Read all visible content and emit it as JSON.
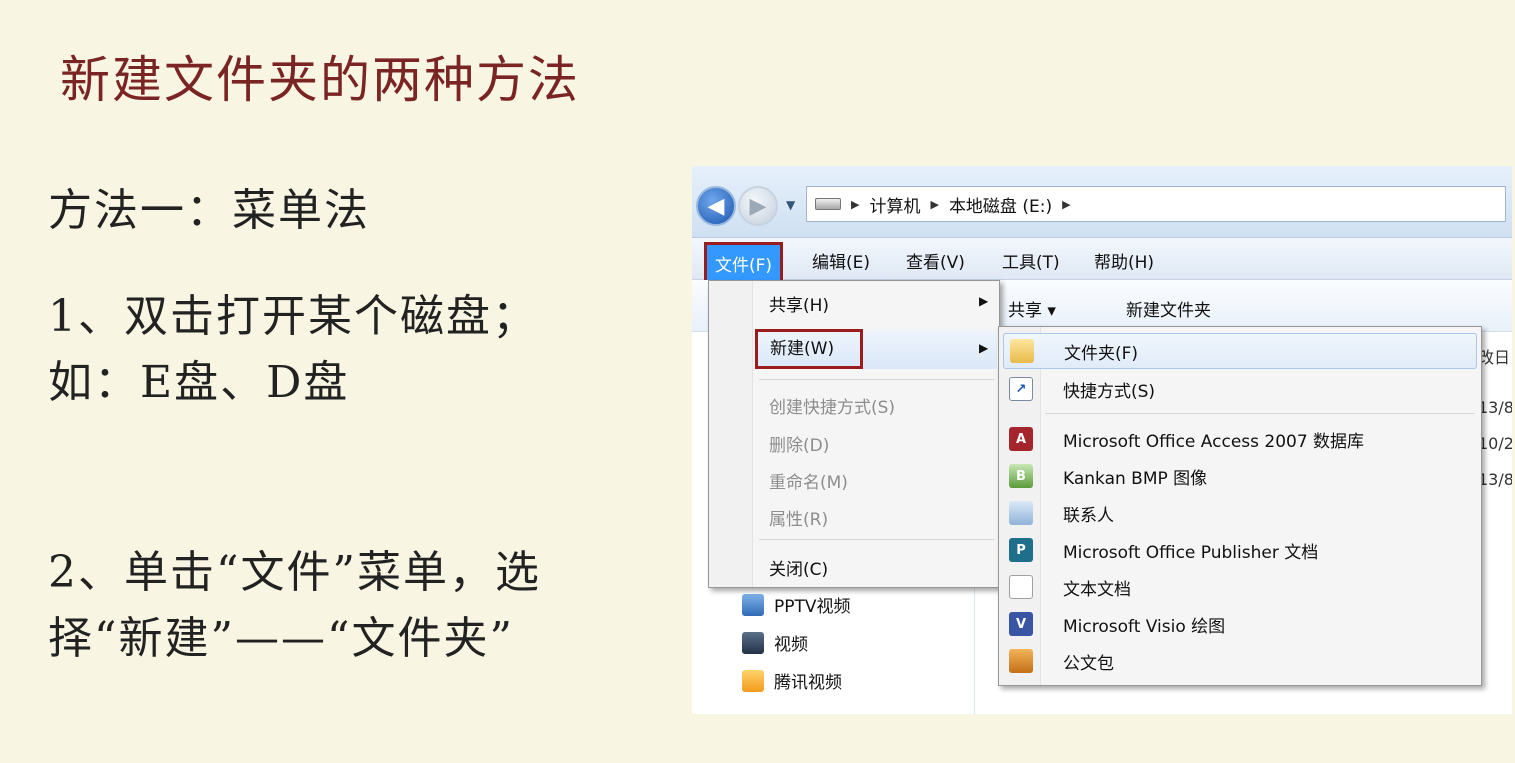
{
  "slide": {
    "title": "新建文件夹的两种方法",
    "method_heading": "方法一：菜单法",
    "step1": "1、双击打开某个磁盘；如：E盘、D盘",
    "step2": "2、单击“文件”菜单，选择“新建”——“文件夹”"
  },
  "explorer": {
    "breadcrumb": [
      "计算机",
      "本地磁盘 (E:)"
    ],
    "menu": {
      "file": "文件(F)",
      "edit": "编辑(E)",
      "view": "查看(V)",
      "tools": "工具(T)",
      "help": "帮助(H)"
    },
    "toolbar": {
      "share": "共享 ▾",
      "new_folder": "新建文件夹"
    },
    "date_col_header": "改日",
    "date_cells": [
      "13/8",
      "10/2",
      "13/8"
    ],
    "nav_items": [
      "PPTV视频",
      "视频",
      "腾讯视频"
    ],
    "file_menu": {
      "share": "共享(H)",
      "new": "新建(W)",
      "create_shortcut": "创建快捷方式(S)",
      "delete": "删除(D)",
      "rename": "重命名(M)",
      "properties": "属性(R)",
      "close": "关闭(C)"
    },
    "new_submenu": {
      "folder": "文件夹(F)",
      "shortcut": "快捷方式(S)",
      "access": "Microsoft Office Access 2007 数据库",
      "bmp": "Kankan BMP 图像",
      "contact": "联系人",
      "publisher": "Microsoft Office Publisher 文档",
      "text": "文本文档",
      "visio": "Microsoft Visio 绘图",
      "briefcase": "公文包"
    }
  },
  "colors": {
    "title": "#7a2424",
    "background": "#f8f5e2",
    "highlight_box": "#9b1c1c",
    "menu_selected": "#3399ff"
  }
}
